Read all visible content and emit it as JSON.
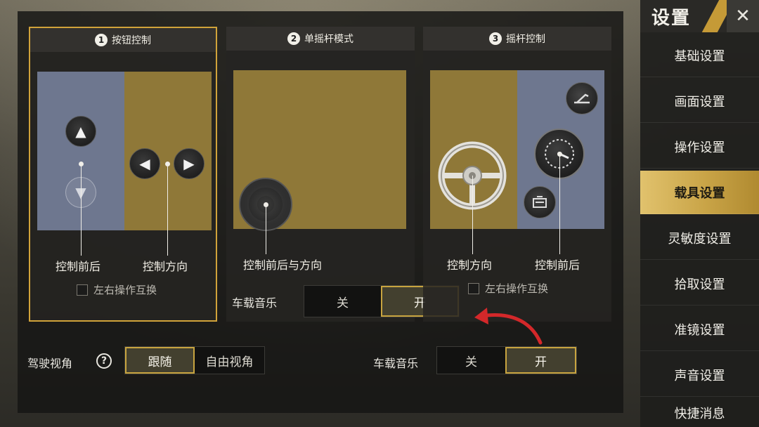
{
  "modes": [
    {
      "num": "1",
      "title": "按钮控制",
      "labels": [
        "控制前后",
        "控制方向"
      ],
      "checkbox": "左右操作互换"
    },
    {
      "num": "2",
      "title": "单摇杆模式",
      "labels": [
        "控制前后与方向"
      ]
    },
    {
      "num": "3",
      "title": "摇杆控制",
      "labels": [
        "控制方向",
        "控制前后"
      ],
      "checkbox": "左右操作互换"
    }
  ],
  "icons": {
    "up": "▲",
    "down": "▼",
    "left": "◀",
    "right": "▶",
    "handbrake": "handbrake-icon",
    "horn": "horn-icon",
    "speedometer": "speedometer-icon",
    "steering": "steering-wheel-icon"
  },
  "inline_music": {
    "label": "车载音乐",
    "off": "关",
    "on": "开",
    "selected": "开"
  },
  "driving_view": {
    "label": "驾驶视角",
    "help": "?",
    "options": [
      "跟随",
      "自由视角"
    ],
    "selected": "跟随"
  },
  "bottom_music": {
    "label": "车载音乐",
    "off": "关",
    "on": "开",
    "selected": "开"
  },
  "sidebar": {
    "title": "设置",
    "close": "✕",
    "items": [
      "基础设置",
      "画面设置",
      "操作设置",
      "载具设置",
      "灵敏度设置",
      "拾取设置",
      "准镜设置",
      "声音设置",
      "快捷消息"
    ],
    "active": "载具设置"
  },
  "colors": {
    "accent": "#c9a447",
    "arrow": "#d4282a",
    "blue_zone": "#6e778f",
    "gold_zone": "#8f7838"
  }
}
